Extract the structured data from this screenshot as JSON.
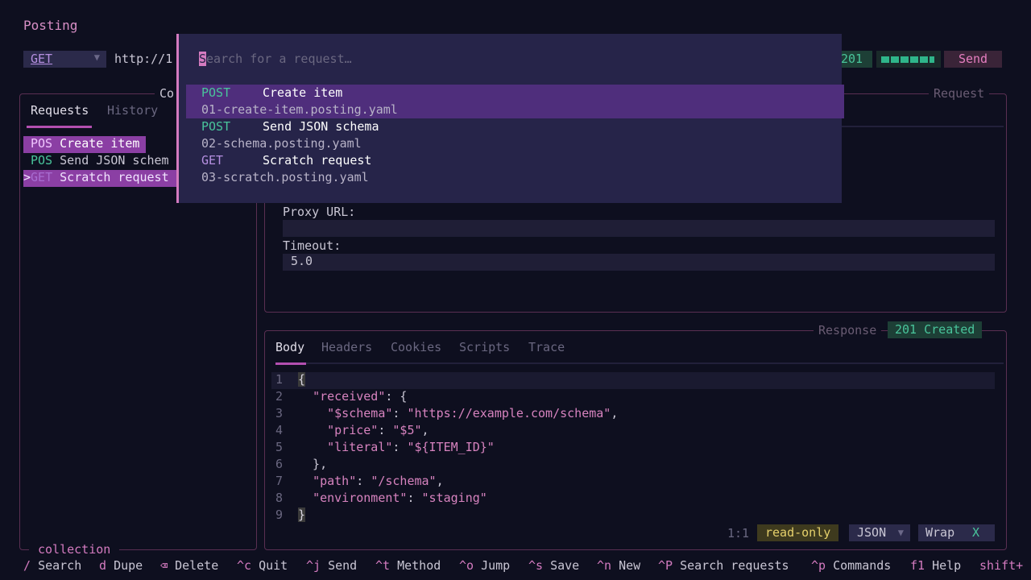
{
  "app": {
    "title": "Posting"
  },
  "url_bar": {
    "method": "GET",
    "url": "http://1",
    "status_code": "201",
    "send_label": "Send"
  },
  "collection": {
    "title": "Co",
    "tabs": [
      "Requests",
      "History"
    ],
    "items": [
      {
        "prefix": "",
        "method": "POS",
        "name": "Create item"
      },
      {
        "prefix": "",
        "method": "POS",
        "name": "Send JSON schem"
      },
      {
        "prefix": ">",
        "method": "GET",
        "name": "Scratch request"
      }
    ],
    "footer": "collection"
  },
  "request": {
    "title": "Request",
    "proxy_label": "Proxy URL:",
    "proxy_value": "",
    "timeout_label": "Timeout:",
    "timeout_value": "5.0"
  },
  "response": {
    "title": "Response",
    "status": "201 Created",
    "tabs": [
      "Body",
      "Headers",
      "Cookies",
      "Scripts",
      "Trace"
    ],
    "code_lines": [
      {
        "n": "1"
      },
      {
        "n": "2"
      },
      {
        "n": "3"
      },
      {
        "n": "4"
      },
      {
        "n": "5"
      },
      {
        "n": "6"
      },
      {
        "n": "7"
      },
      {
        "n": "8"
      },
      {
        "n": "9"
      }
    ],
    "json": {
      "received_key": "\"received\"",
      "schema_key": "\"$schema\"",
      "schema_value": "\"https://example.com/schema\"",
      "price_key": "\"price\"",
      "price_value": "\"$5\"",
      "literal_key": "\"literal\"",
      "literal_value": "\"${ITEM_ID}\"",
      "path_key": "\"path\"",
      "path_value": "\"/schema\"",
      "env_key": "\"environment\"",
      "env_value": "\"staging\""
    },
    "cursor": "1:1",
    "read_only": "read-only",
    "language": "JSON",
    "wrap_label": "Wrap",
    "wrap_state": "X"
  },
  "footer": [
    {
      "key": "/",
      "desc": "Search"
    },
    {
      "key": "d",
      "desc": "Dupe"
    },
    {
      "key": "⌫",
      "desc": "Delete"
    },
    {
      "key": "^c",
      "desc": "Quit"
    },
    {
      "key": "^j",
      "desc": "Send"
    },
    {
      "key": "^t",
      "desc": "Method"
    },
    {
      "key": "^o",
      "desc": "Jump"
    },
    {
      "key": "^s",
      "desc": "Save"
    },
    {
      "key": "^n",
      "desc": "New"
    },
    {
      "key": "^P",
      "desc": "Search requests"
    },
    {
      "key": "^p",
      "desc": "Commands"
    },
    {
      "key": "f1",
      "desc": "Help"
    },
    {
      "key": "shift+",
      "desc": ""
    }
  ],
  "palette": {
    "search_first": "S",
    "search_rest": "earch for a request…",
    "items": [
      {
        "method": "POST",
        "title": "Create item",
        "file": "01-create-item.posting.yaml"
      },
      {
        "method": "POST",
        "title": "Send JSON schema",
        "file": "02-schema.posting.yaml"
      },
      {
        "method": "GET",
        "title": "Scratch request",
        "file": "03-scratch.posting.yaml"
      }
    ]
  },
  "colors": {
    "background": "#0e0f1f",
    "accent": "#d47bc0",
    "selection": "#8b3fa4",
    "success": "#49c49b",
    "palette_bg": "#262449"
  }
}
